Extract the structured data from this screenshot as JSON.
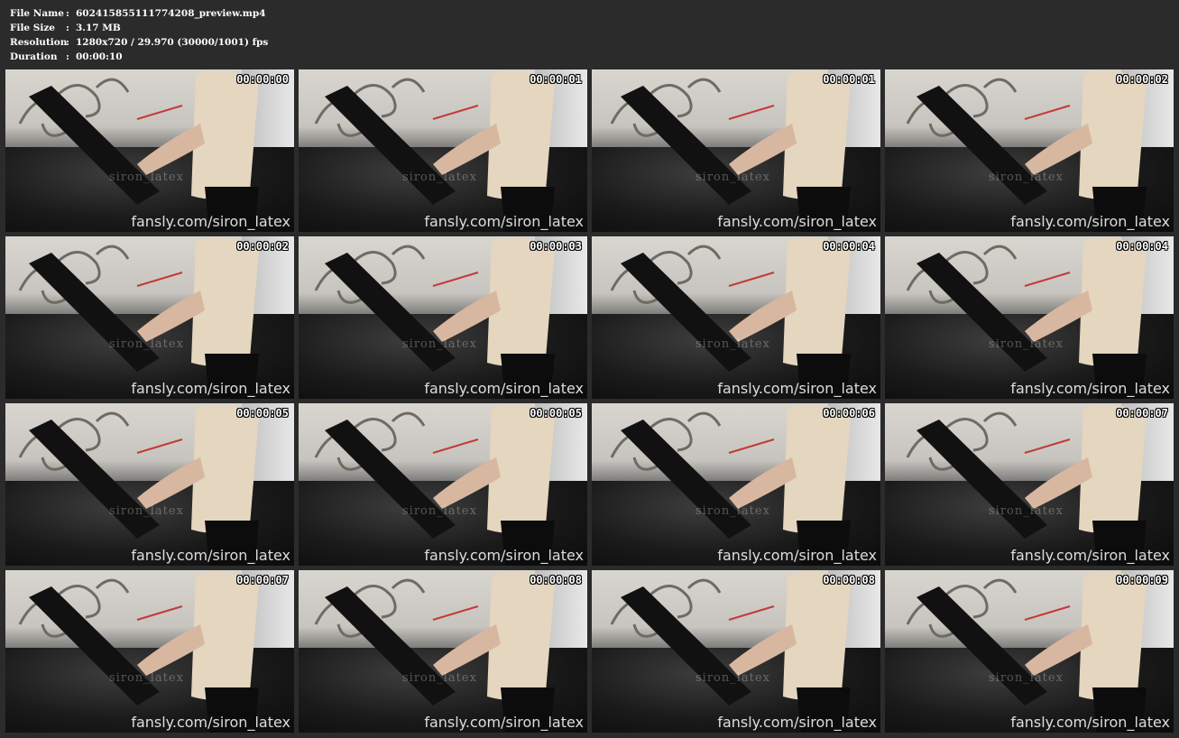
{
  "info": [
    {
      "label": "File Name",
      "sep": ":",
      "value": "602415855111774208_preview.mp4"
    },
    {
      "label": "File Size",
      "sep": ":",
      "value": "3.17 MB"
    },
    {
      "label": "Resolution",
      "sep": ":",
      "value": "1280x720 / 29.970 (30000/1001) fps"
    },
    {
      "label": "Duration",
      "sep": ":",
      "value": "00:00:10"
    }
  ],
  "watermark_small": "siron_latex",
  "watermark_big": "fansly.com/siron_latex",
  "timestamps": [
    "00:00:00",
    "00:00:01",
    "00:00:01",
    "00:00:02",
    "00:00:02",
    "00:00:03",
    "00:00:04",
    "00:00:04",
    "00:00:05",
    "00:00:05",
    "00:00:06",
    "00:00:07",
    "00:00:07",
    "00:00:08",
    "00:00:08",
    "00:00:09"
  ]
}
